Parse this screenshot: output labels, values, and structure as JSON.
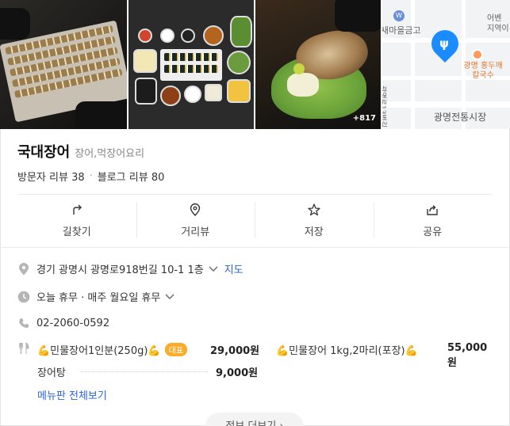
{
  "photos": {
    "more_count": "+817"
  },
  "map": {
    "labels": {
      "bank": "새마을금고",
      "area": "어벤 지역이",
      "restaurant": "광명 홍두깨칼국수",
      "road": "광명로13번길",
      "market": "광명전통시장"
    }
  },
  "place": {
    "name": "국대장어",
    "category": "장어,먹장어요리",
    "visitor_review_label": "방문자 리뷰 38",
    "blog_review_label": "블로그 리뷰 80"
  },
  "actions": [
    {
      "label": "길찾기",
      "icon": "directions-icon"
    },
    {
      "label": "거리뷰",
      "icon": "streetview-icon"
    },
    {
      "label": "저장",
      "icon": "star-icon"
    },
    {
      "label": "공유",
      "icon": "share-icon"
    }
  ],
  "info": {
    "address": "경기 광명시 광명로918번길 10-1 1층",
    "map_link": "지도",
    "hours": "오늘 휴무 · 매주 월요일 휴무",
    "phone": "02-2060-0592"
  },
  "menu": {
    "items": [
      {
        "name": "💪민물장어1인분(250g)💪",
        "badge": "대표",
        "price": "29,000원"
      },
      {
        "name": "💪민물장어 1kg,2마리(포장)💪",
        "price": "55,000원"
      },
      {
        "name": "장어탕",
        "price": "9,000원"
      }
    ],
    "view_all": "메뉴판 전체보기"
  },
  "more_button": "정보 더보기 ›",
  "colors": {
    "link": "#2a64d6",
    "badge": "#fbac2b",
    "map_pin": "#1a8cff"
  }
}
